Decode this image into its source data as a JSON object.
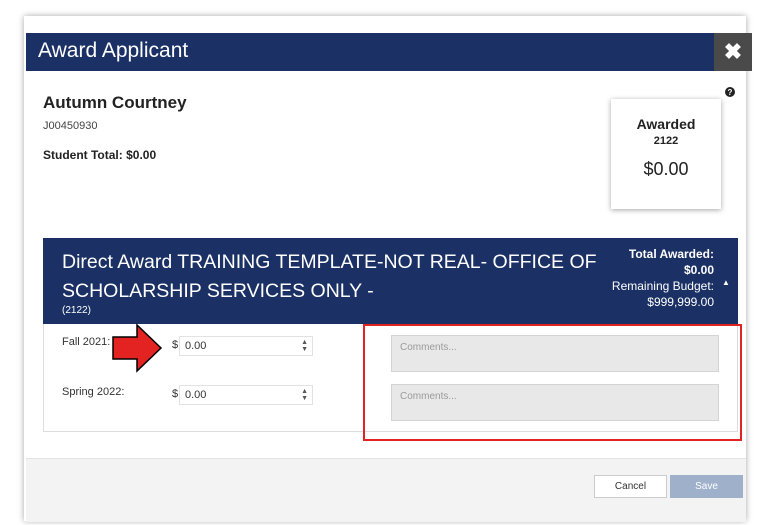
{
  "dialog": {
    "title": "Award Applicant",
    "close_glyph": "✖"
  },
  "student": {
    "name": "Autumn Courtney",
    "id": "J00450930",
    "total_label": "Student Total:",
    "total_value": "$0.00"
  },
  "summary_card": {
    "label": "Awarded",
    "code": "2122",
    "amount": "$0.00"
  },
  "award": {
    "title": "Direct Award TRAINING TEMPLATE-NOT REAL- OFFICE OF SCHOLARSHIP SERVICES ONLY -",
    "code": "(2122)",
    "total_awarded_label": "Total Awarded:",
    "total_awarded_value": "$0.00",
    "remaining_label": "Remaining Budget:",
    "remaining_value": "$999,999.00"
  },
  "terms": [
    {
      "label": "Fall 2021:",
      "currency": "$",
      "value": "0.00",
      "comment_placeholder": "Comments..."
    },
    {
      "label": "Spring 2022:",
      "currency": "$",
      "value": "0.00",
      "comment_placeholder": "Comments..."
    }
  ],
  "footer": {
    "cancel_label": "Cancel",
    "save_label": "Save"
  },
  "colors": {
    "header": "#1b3166",
    "annotation": "#e32222",
    "save_disabled": "#9fb0cb"
  }
}
